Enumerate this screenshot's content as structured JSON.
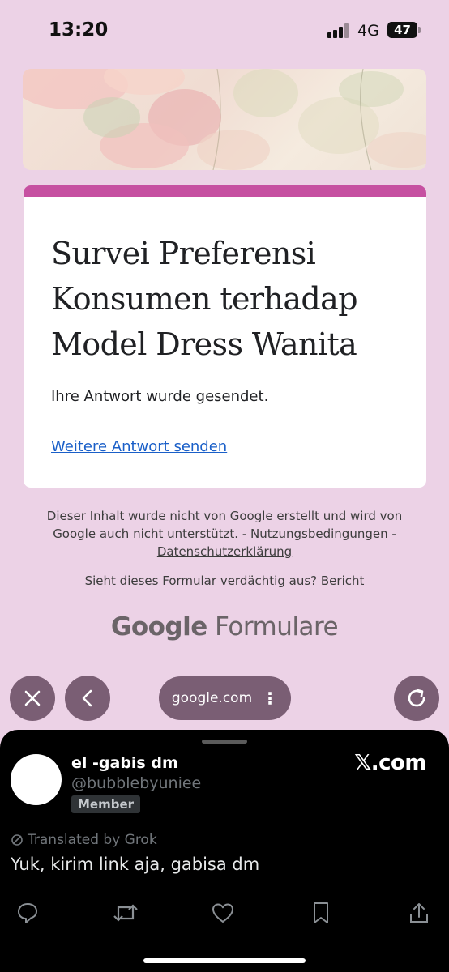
{
  "status_bar": {
    "time": "13:20",
    "network": "4G",
    "battery": "47"
  },
  "form": {
    "title": "Survei Preferensi Konsumen terhadap Model Dress Wanita",
    "message": "Ihre Antwort wurde gesendet.",
    "link": "Weitere Antwort senden",
    "accent_color": "#c650a1"
  },
  "footer": {
    "disclaimer_text": "Dieser Inhalt wurde nicht von Google erstellt und wird von Google auch nicht unterstützt. -",
    "terms_link": "Nutzungsbedingungen",
    "separator": "-",
    "privacy_link": "Datenschutzerklärung",
    "report_text": "Sieht dieses Formular verdächtig aus?",
    "report_link": "Bericht",
    "logo_google": "Google",
    "logo_product": "Formulare"
  },
  "browser": {
    "url": "google.com",
    "menu": "⋮"
  },
  "tweet": {
    "name": "el -gabis dm",
    "handle": "@bubblebyuniee",
    "badge": "Member",
    "source": "𝕏.com",
    "translated": "Translated by Grok",
    "text": "Yuk, kirim link aja, gabisa dm"
  },
  "icons": [
    "close-icon",
    "back-icon",
    "reload-icon",
    "reply-icon",
    "repost-icon",
    "like-icon",
    "bookmark-icon",
    "share-icon",
    "translate-icon"
  ]
}
